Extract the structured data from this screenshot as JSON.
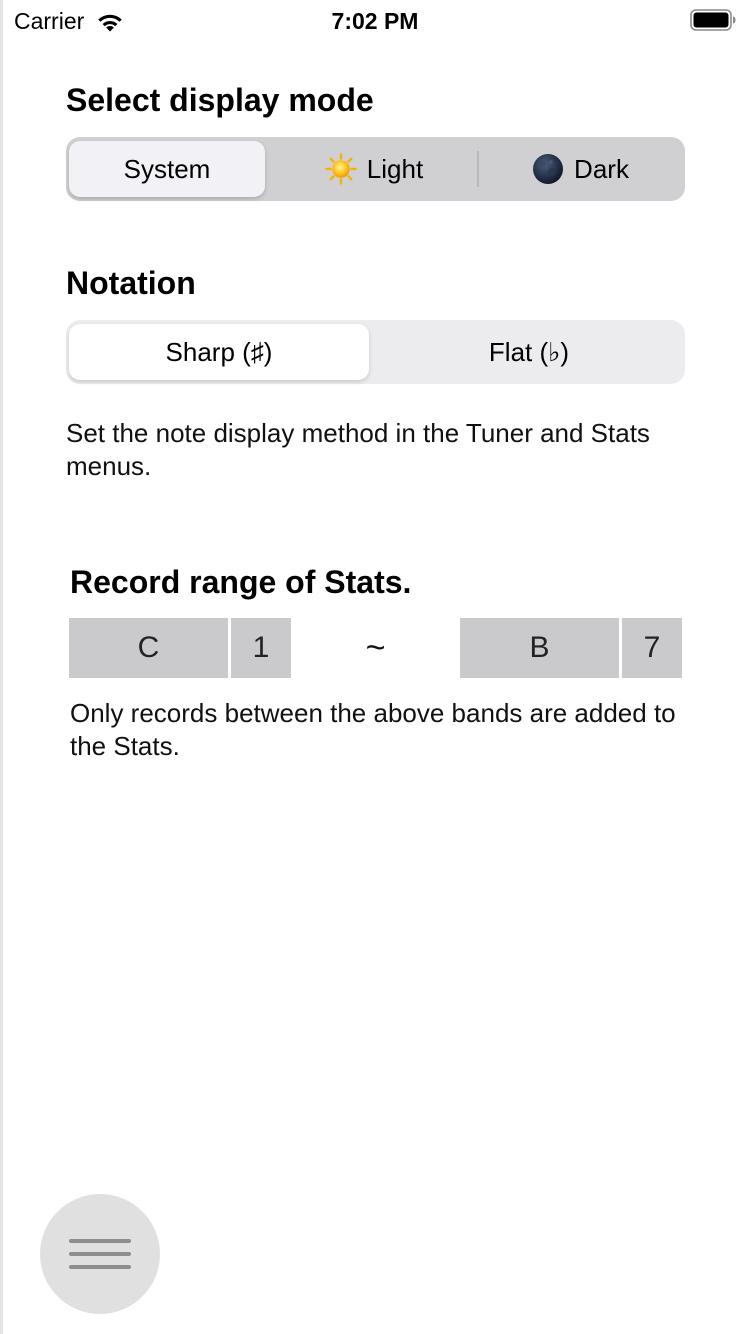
{
  "status_bar": {
    "carrier": "Carrier",
    "time": "7:02 PM",
    "wifi_icon": "wifi-icon",
    "battery_icon": "battery-icon"
  },
  "display_mode": {
    "title": "Select display mode",
    "options": [
      {
        "label": "System",
        "icon": "",
        "selected": true
      },
      {
        "label": "Light",
        "icon": "sun-icon",
        "selected": false
      },
      {
        "label": "Dark",
        "icon": "moon-icon",
        "selected": false
      }
    ]
  },
  "notation": {
    "title": "Notation",
    "options": [
      {
        "label": "Sharp (♯)",
        "selected": true
      },
      {
        "label": "Flat (♭)",
        "selected": false
      }
    ],
    "description": "Set the note display method in the Tuner and Stats menus."
  },
  "record_range": {
    "title": "Record range of Stats.",
    "from_note": "C",
    "from_octave": "1",
    "separator": "~",
    "to_note": "B",
    "to_octave": "7",
    "description": "Only records between the above bands are added to the Stats."
  },
  "menu_button": {
    "icon": "hamburger-menu-icon"
  },
  "colors": {
    "mode_track": "#d0d0d3",
    "notation_track": "#ececee",
    "range_cell": "#cacacc",
    "menu_button": "#e0e0e0"
  }
}
